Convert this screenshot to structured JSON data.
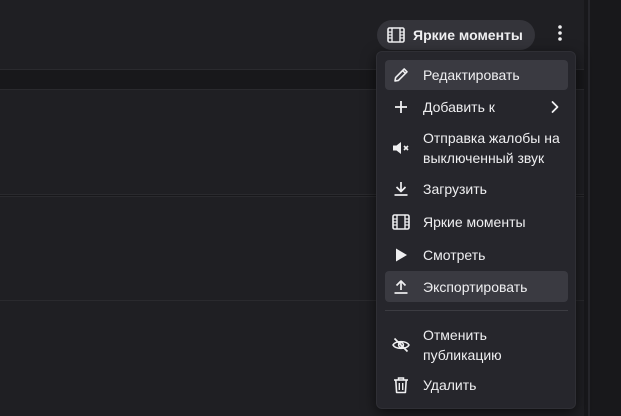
{
  "header": {
    "highlights_button_label": "Яркие моменты",
    "more_icon": "kebab-icon"
  },
  "menu": {
    "items": [
      {
        "label": "Редактировать",
        "icon": "pencil-icon",
        "highlighted": true
      },
      {
        "label": "Добавить к",
        "icon": "plus-icon",
        "has_submenu": true
      },
      {
        "label": "Отправка жалобы на выключенный звук",
        "icon": "muted-speaker-icon"
      },
      {
        "label": "Загрузить",
        "icon": "download-icon"
      },
      {
        "label": "Яркие моменты",
        "icon": "film-icon"
      },
      {
        "label": "Смотреть",
        "icon": "play-icon"
      },
      {
        "label": "Экспортировать",
        "icon": "upload-icon",
        "highlighted": true
      },
      {
        "label": "Отменить публикацию",
        "icon": "eye-off-icon"
      },
      {
        "label": "Удалить",
        "icon": "trash-icon"
      }
    ]
  },
  "colors": {
    "background": "#18181b",
    "surface": "#1f1f23",
    "menu_bg": "#26262c",
    "highlight": "#3a3a41",
    "text": "#efeff1"
  }
}
